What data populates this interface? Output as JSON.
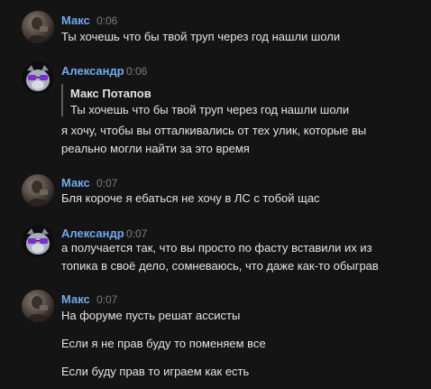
{
  "messages": [
    {
      "author": "Макс",
      "time": "0:06",
      "lines": [
        "Ты хочешь что бы твой труп через год нашли шоли"
      ]
    },
    {
      "author": "Александр",
      "time": "0:06",
      "quote": {
        "author": "Макс Потапов",
        "text": "Ты хочешь что бы твой труп через год нашли шоли"
      },
      "lines": [
        "я хочу, чтобы вы отталкивались от тех улик, которые вы",
        "реально могли найти за это время"
      ]
    },
    {
      "author": "Макс",
      "time": "0:07",
      "lines": [
        "Бля короче я ебаться не хочу в ЛС с тобой щас"
      ]
    },
    {
      "author": "Александр",
      "time": "0:07",
      "lines": [
        "а получается так, что вы просто по фасту вставили их из",
        "топика в своё дело, сомневаюсь, что даже как-то обыграв"
      ]
    },
    {
      "author": "Макс",
      "time": "0:07",
      "lines": [
        "На форуме пусть решат ассисты",
        "Если я не прав буду то поменяем все",
        "Если буду прав то играем как есть"
      ]
    }
  ]
}
